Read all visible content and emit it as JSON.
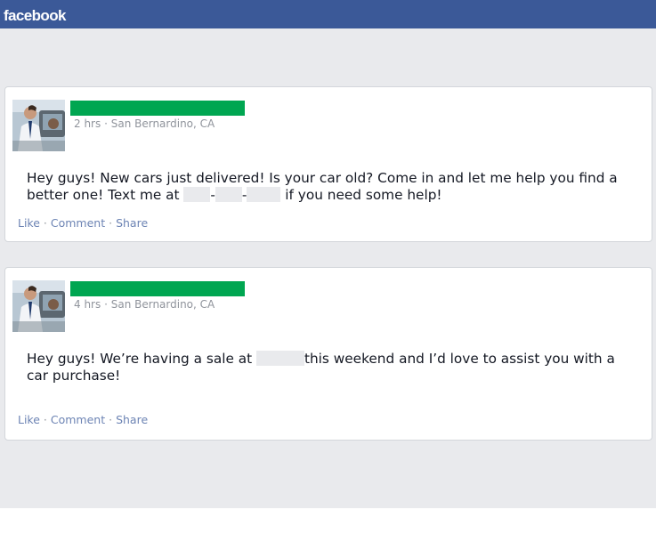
{
  "header": {
    "logo_text": "facebook",
    "bar_color": "#3b5998"
  },
  "feed": {
    "background_color": "#e9eaed",
    "posts": [
      {
        "time": "2 hrs",
        "location": "San Bernardino, CA",
        "text_1": "Hey guys!  New cars just delivered!  Is your car old?  Come in and let me help you find a better one!  Text me at",
        "phone_sep_1": "-",
        "phone_sep_2": "-",
        "text_2": "if you need some help!",
        "actions": {
          "like": "Like",
          "comment": "Comment",
          "share": "Share",
          "separator": "·"
        }
      },
      {
        "time": "4 hrs",
        "location": "San Bernardino, CA",
        "text_1": "Hey guys!  We’re having a sale at",
        "text_2": "this weekend and I’d love to assist you with a car purchase!",
        "actions": {
          "like": "Like",
          "comment": "Comment",
          "share": "Share",
          "separator": "·"
        }
      }
    ],
    "name_redaction_color": "#00a651"
  }
}
